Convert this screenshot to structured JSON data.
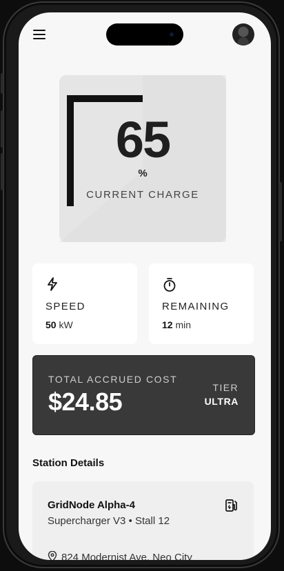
{
  "charge": {
    "value": "65",
    "unit": "%",
    "label": "CURRENT CHARGE",
    "percent": 65
  },
  "stats": {
    "speed": {
      "label": "SPEED",
      "value": "50",
      "unit": "kW",
      "icon": "lightning-icon"
    },
    "remaining": {
      "label": "REMAINING",
      "value": "12",
      "unit": "min",
      "icon": "stopwatch-icon"
    }
  },
  "cost": {
    "label": "TOTAL ACCRUED COST",
    "value": "$24.85",
    "tier_label": "TIER",
    "tier_value": "ULTRA"
  },
  "station": {
    "section_title": "Station Details",
    "name": "GridNode Alpha-4",
    "type": "Supercharger V3",
    "stall": "Stall 12",
    "address": "824 Modernist Ave, Neo City",
    "icon": "fuel-pump-icon"
  },
  "icons": {
    "menu": "hamburger-menu-icon",
    "avatar": "user-avatar",
    "location": "map-pin-icon"
  },
  "colors": {
    "screen_bg": "#f7f7f7",
    "gauge_fill": "#111111",
    "gauge_track": "#e5e5e5",
    "cost_card": "#393939"
  }
}
